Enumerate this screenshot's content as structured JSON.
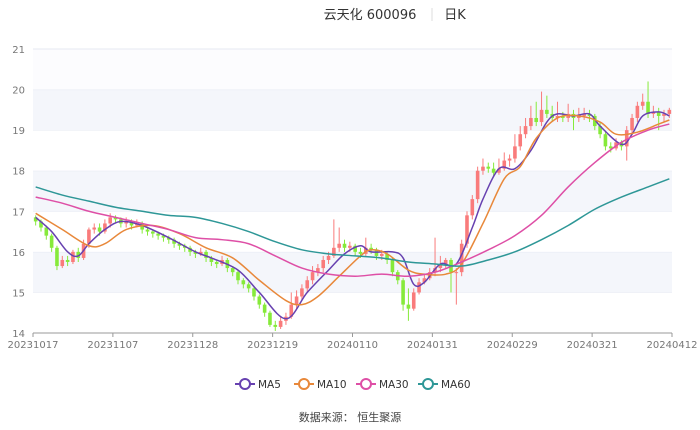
{
  "header": {
    "stock_name": "云天化 600096",
    "period": "日K"
  },
  "footer": {
    "source": "数据来源：  恒生聚源"
  },
  "chart_data": {
    "type": "candlestick",
    "title": "云天化 600096",
    "ylim": [
      14,
      21
    ],
    "y_ticks": [
      "14",
      "15",
      "16",
      "17",
      "18",
      "19",
      "20",
      "21"
    ],
    "x_ticks": [
      {
        "day": 0,
        "label": "20231017"
      },
      {
        "day": 15,
        "label": "20231107"
      },
      {
        "day": 30,
        "label": "20231128"
      },
      {
        "day": 45,
        "label": "20231219"
      },
      {
        "day": 60,
        "label": "20240110"
      },
      {
        "day": 75,
        "label": "20240131"
      },
      {
        "day": 90,
        "label": "20240229"
      },
      {
        "day": 105,
        "label": "20240321"
      },
      {
        "day": 120,
        "label": "20240412"
      }
    ],
    "days": 120,
    "colors": {
      "up": "#f97b7b",
      "down": "#86ea3a",
      "MA5": "#6741b0",
      "MA10": "#e8883a",
      "MA30": "#de4fa6",
      "MA60": "#2e9797"
    },
    "candles_ohlc_note": "[open, close, low, high]",
    "candles": [
      [
        16.85,
        16.75,
        16.65,
        16.9
      ],
      [
        16.75,
        16.6,
        16.5,
        16.8
      ],
      [
        16.6,
        16.4,
        16.3,
        16.65
      ],
      [
        16.4,
        16.1,
        16.0,
        16.45
      ],
      [
        16.1,
        15.65,
        15.55,
        16.15
      ],
      [
        15.65,
        15.8,
        15.6,
        15.9
      ],
      [
        15.8,
        15.75,
        15.65,
        15.9
      ],
      [
        15.75,
        16.0,
        15.7,
        16.05
      ],
      [
        16.0,
        15.85,
        15.75,
        16.1
      ],
      [
        15.85,
        16.2,
        15.8,
        16.3
      ],
      [
        16.2,
        16.55,
        16.1,
        16.6
      ],
      [
        16.55,
        16.6,
        16.45,
        16.7
      ],
      [
        16.6,
        16.5,
        16.4,
        16.7
      ],
      [
        16.5,
        16.7,
        16.45,
        16.8
      ],
      [
        16.7,
        16.85,
        16.6,
        16.95
      ],
      [
        16.85,
        16.8,
        16.7,
        16.9
      ],
      [
        16.8,
        16.7,
        16.6,
        16.85
      ],
      [
        16.7,
        16.75,
        16.6,
        16.85
      ],
      [
        16.75,
        16.65,
        16.55,
        16.8
      ],
      [
        16.65,
        16.7,
        16.6,
        16.8
      ],
      [
        16.7,
        16.55,
        16.45,
        16.75
      ],
      [
        16.55,
        16.5,
        16.4,
        16.6
      ],
      [
        16.5,
        16.45,
        16.35,
        16.55
      ],
      [
        16.45,
        16.4,
        16.3,
        16.5
      ],
      [
        16.4,
        16.35,
        16.25,
        16.45
      ],
      [
        16.35,
        16.3,
        16.2,
        16.4
      ],
      [
        16.3,
        16.2,
        16.1,
        16.35
      ],
      [
        16.2,
        16.15,
        16.05,
        16.25
      ],
      [
        16.15,
        16.1,
        16.0,
        16.2
      ],
      [
        16.1,
        16.0,
        15.9,
        16.15
      ],
      [
        16.0,
        15.95,
        15.85,
        16.05
      ],
      [
        15.95,
        16.0,
        15.9,
        16.1
      ],
      [
        16.0,
        15.85,
        15.75,
        16.05
      ],
      [
        15.85,
        15.75,
        15.65,
        15.9
      ],
      [
        15.75,
        15.7,
        15.6,
        15.8
      ],
      [
        15.7,
        15.8,
        15.65,
        15.9
      ],
      [
        15.8,
        15.6,
        15.5,
        15.85
      ],
      [
        15.6,
        15.5,
        15.4,
        15.65
      ],
      [
        15.5,
        15.3,
        15.2,
        15.55
      ],
      [
        15.3,
        15.2,
        15.1,
        15.35
      ],
      [
        15.2,
        15.1,
        15.0,
        15.25
      ],
      [
        15.1,
        14.9,
        14.8,
        15.15
      ],
      [
        14.9,
        14.7,
        14.6,
        14.95
      ],
      [
        14.7,
        14.5,
        14.4,
        14.75
      ],
      [
        14.5,
        14.2,
        14.15,
        14.55
      ],
      [
        14.2,
        14.15,
        14.05,
        14.3
      ],
      [
        14.15,
        14.3,
        14.1,
        14.4
      ],
      [
        14.3,
        14.4,
        14.2,
        14.5
      ],
      [
        14.4,
        14.7,
        14.35,
        15.0
      ],
      [
        14.7,
        14.9,
        14.6,
        15.05
      ],
      [
        14.9,
        15.1,
        14.8,
        15.2
      ],
      [
        15.1,
        15.3,
        15.0,
        15.4
      ],
      [
        15.3,
        15.5,
        15.2,
        15.65
      ],
      [
        15.5,
        15.6,
        15.4,
        15.7
      ],
      [
        15.6,
        15.8,
        15.5,
        15.9
      ],
      [
        15.8,
        15.9,
        15.7,
        16.0
      ],
      [
        15.9,
        16.1,
        15.85,
        16.8
      ],
      [
        16.1,
        16.2,
        16.0,
        16.6
      ],
      [
        16.2,
        16.1,
        16.0,
        16.3
      ],
      [
        16.1,
        16.15,
        16.0,
        16.25
      ],
      [
        16.15,
        16.0,
        15.9,
        16.2
      ],
      [
        16.0,
        15.95,
        15.85,
        16.1
      ],
      [
        15.95,
        16.1,
        15.9,
        16.35
      ],
      [
        16.1,
        16.05,
        15.95,
        16.2
      ],
      [
        16.05,
        15.9,
        15.8,
        16.1
      ],
      [
        15.9,
        15.95,
        15.8,
        16.05
      ],
      [
        15.95,
        15.8,
        15.7,
        16.0
      ],
      [
        15.8,
        15.5,
        15.4,
        15.85
      ],
      [
        15.5,
        15.3,
        15.2,
        15.55
      ],
      [
        15.3,
        14.7,
        14.55,
        15.35
      ],
      [
        14.7,
        14.6,
        14.3,
        15.1
      ],
      [
        14.6,
        15.0,
        14.55,
        15.1
      ],
      [
        15.0,
        15.25,
        14.95,
        15.35
      ],
      [
        15.25,
        15.35,
        15.2,
        15.45
      ],
      [
        15.35,
        15.5,
        15.3,
        15.6
      ],
      [
        15.5,
        15.6,
        15.4,
        16.35
      ],
      [
        15.6,
        15.7,
        15.5,
        15.9
      ],
      [
        15.7,
        15.8,
        15.6,
        15.85
      ],
      [
        15.8,
        15.5,
        15.0,
        15.85
      ],
      [
        15.5,
        15.5,
        14.7,
        15.6
      ],
      [
        15.5,
        16.2,
        15.4,
        16.3
      ],
      [
        16.2,
        16.9,
        16.1,
        17.0
      ],
      [
        16.9,
        17.3,
        16.8,
        17.4
      ],
      [
        17.3,
        18.0,
        17.2,
        18.1
      ],
      [
        18.0,
        18.1,
        17.9,
        18.3
      ],
      [
        18.1,
        18.05,
        17.95,
        18.2
      ],
      [
        18.05,
        17.95,
        17.85,
        18.2
      ],
      [
        17.95,
        18.05,
        17.9,
        18.3
      ],
      [
        18.05,
        18.25,
        18.0,
        18.45
      ],
      [
        18.25,
        18.3,
        18.1,
        18.4
      ],
      [
        18.3,
        18.6,
        18.2,
        18.9
      ],
      [
        18.6,
        18.9,
        18.5,
        19.1
      ],
      [
        18.9,
        19.1,
        18.8,
        19.3
      ],
      [
        19.1,
        19.3,
        19.0,
        19.6
      ],
      [
        19.3,
        19.2,
        19.1,
        19.7
      ],
      [
        19.2,
        19.5,
        19.1,
        19.95
      ],
      [
        19.5,
        19.4,
        19.3,
        19.85
      ],
      [
        19.4,
        19.3,
        19.2,
        19.6
      ],
      [
        19.3,
        19.35,
        19.2,
        19.7
      ],
      [
        19.35,
        19.3,
        19.2,
        19.45
      ],
      [
        19.3,
        19.4,
        19.2,
        19.65
      ],
      [
        19.4,
        19.3,
        19.0,
        19.5
      ],
      [
        19.3,
        19.35,
        19.2,
        19.55
      ],
      [
        19.35,
        19.4,
        19.25,
        19.55
      ],
      [
        19.4,
        19.35,
        19.2,
        19.5
      ],
      [
        19.35,
        19.1,
        19.0,
        19.4
      ],
      [
        19.1,
        18.9,
        18.8,
        19.2
      ],
      [
        18.9,
        18.6,
        18.5,
        18.95
      ],
      [
        18.6,
        18.55,
        18.45,
        18.7
      ],
      [
        18.55,
        18.7,
        18.5,
        18.8
      ],
      [
        18.7,
        18.6,
        18.5,
        18.75
      ],
      [
        18.6,
        19.0,
        18.25,
        19.1
      ],
      [
        19.0,
        19.3,
        18.9,
        19.4
      ],
      [
        19.3,
        19.6,
        19.2,
        19.7
      ],
      [
        19.6,
        19.7,
        19.5,
        19.9
      ],
      [
        19.7,
        19.4,
        19.3,
        20.2
      ],
      [
        19.4,
        19.45,
        19.3,
        19.6
      ],
      [
        19.45,
        19.35,
        19.0,
        19.55
      ],
      [
        19.35,
        19.4,
        19.2,
        19.5
      ],
      [
        19.4,
        19.5,
        19.3,
        19.55
      ]
    ],
    "series": [
      {
        "name": "MA5",
        "points": [
          [
            0,
            16.85
          ],
          [
            3,
            16.5
          ],
          [
            6,
            16.0
          ],
          [
            8,
            15.9
          ],
          [
            10,
            16.2
          ],
          [
            13,
            16.55
          ],
          [
            16,
            16.75
          ],
          [
            20,
            16.65
          ],
          [
            25,
            16.35
          ],
          [
            30,
            16.0
          ],
          [
            33,
            15.85
          ],
          [
            38,
            15.55
          ],
          [
            42,
            15.0
          ],
          [
            47,
            14.35
          ],
          [
            51,
            15.0
          ],
          [
            55,
            15.55
          ],
          [
            58,
            15.95
          ],
          [
            61,
            16.15
          ],
          [
            63,
            16.0
          ],
          [
            67,
            16.0
          ],
          [
            69,
            15.85
          ],
          [
            71,
            15.2
          ],
          [
            73,
            15.25
          ],
          [
            76,
            15.7
          ],
          [
            79,
            15.7
          ],
          [
            82,
            16.6
          ],
          [
            84,
            17.3
          ],
          [
            87,
            18.05
          ],
          [
            90,
            18.05
          ],
          [
            93,
            18.5
          ],
          [
            96,
            19.2
          ],
          [
            98,
            19.4
          ],
          [
            101,
            19.35
          ],
          [
            104,
            19.4
          ],
          [
            106,
            19.1
          ],
          [
            110,
            18.65
          ],
          [
            112,
            18.9
          ],
          [
            114,
            19.35
          ],
          [
            117,
            19.45
          ],
          [
            119,
            19.35
          ]
        ]
      },
      {
        "name": "MA10",
        "points": [
          [
            0,
            16.95
          ],
          [
            5,
            16.55
          ],
          [
            10,
            16.15
          ],
          [
            13,
            16.2
          ],
          [
            17,
            16.55
          ],
          [
            22,
            16.65
          ],
          [
            27,
            16.45
          ],
          [
            32,
            16.1
          ],
          [
            37,
            15.85
          ],
          [
            42,
            15.3
          ],
          [
            47,
            14.8
          ],
          [
            50,
            14.7
          ],
          [
            53,
            14.9
          ],
          [
            57,
            15.4
          ],
          [
            61,
            15.9
          ],
          [
            63,
            16.05
          ],
          [
            66,
            15.95
          ],
          [
            70,
            15.55
          ],
          [
            73,
            15.45
          ],
          [
            77,
            15.45
          ],
          [
            80,
            15.7
          ],
          [
            84,
            16.7
          ],
          [
            88,
            17.8
          ],
          [
            91,
            18.1
          ],
          [
            94,
            18.8
          ],
          [
            98,
            19.3
          ],
          [
            102,
            19.35
          ],
          [
            106,
            19.2
          ],
          [
            109,
            18.9
          ],
          [
            113,
            18.95
          ],
          [
            117,
            19.15
          ],
          [
            119,
            19.25
          ]
        ]
      },
      {
        "name": "MA30",
        "points": [
          [
            0,
            17.35
          ],
          [
            5,
            17.2
          ],
          [
            10,
            17.0
          ],
          [
            15,
            16.85
          ],
          [
            20,
            16.7
          ],
          [
            25,
            16.55
          ],
          [
            30,
            16.35
          ],
          [
            35,
            16.3
          ],
          [
            40,
            16.2
          ],
          [
            45,
            15.9
          ],
          [
            50,
            15.6
          ],
          [
            55,
            15.45
          ],
          [
            60,
            15.4
          ],
          [
            65,
            15.45
          ],
          [
            70,
            15.4
          ],
          [
            75,
            15.5
          ],
          [
            80,
            15.75
          ],
          [
            85,
            16.05
          ],
          [
            90,
            16.4
          ],
          [
            95,
            16.9
          ],
          [
            100,
            17.6
          ],
          [
            105,
            18.2
          ],
          [
            110,
            18.7
          ],
          [
            115,
            19.0
          ],
          [
            119,
            19.15
          ]
        ]
      },
      {
        "name": "MA60",
        "points": [
          [
            0,
            17.6
          ],
          [
            5,
            17.4
          ],
          [
            10,
            17.25
          ],
          [
            15,
            17.1
          ],
          [
            20,
            17.0
          ],
          [
            25,
            16.9
          ],
          [
            30,
            16.85
          ],
          [
            35,
            16.7
          ],
          [
            40,
            16.5
          ],
          [
            45,
            16.25
          ],
          [
            50,
            16.05
          ],
          [
            55,
            15.95
          ],
          [
            60,
            15.9
          ],
          [
            65,
            15.85
          ],
          [
            70,
            15.75
          ],
          [
            75,
            15.7
          ],
          [
            80,
            15.65
          ],
          [
            85,
            15.8
          ],
          [
            90,
            16.0
          ],
          [
            95,
            16.3
          ],
          [
            100,
            16.65
          ],
          [
            105,
            17.05
          ],
          [
            110,
            17.35
          ],
          [
            115,
            17.6
          ],
          [
            119,
            17.8
          ]
        ]
      }
    ],
    "legend": [
      "MA5",
      "MA10",
      "MA30",
      "MA60"
    ],
    "legend_position": "bottom"
  }
}
